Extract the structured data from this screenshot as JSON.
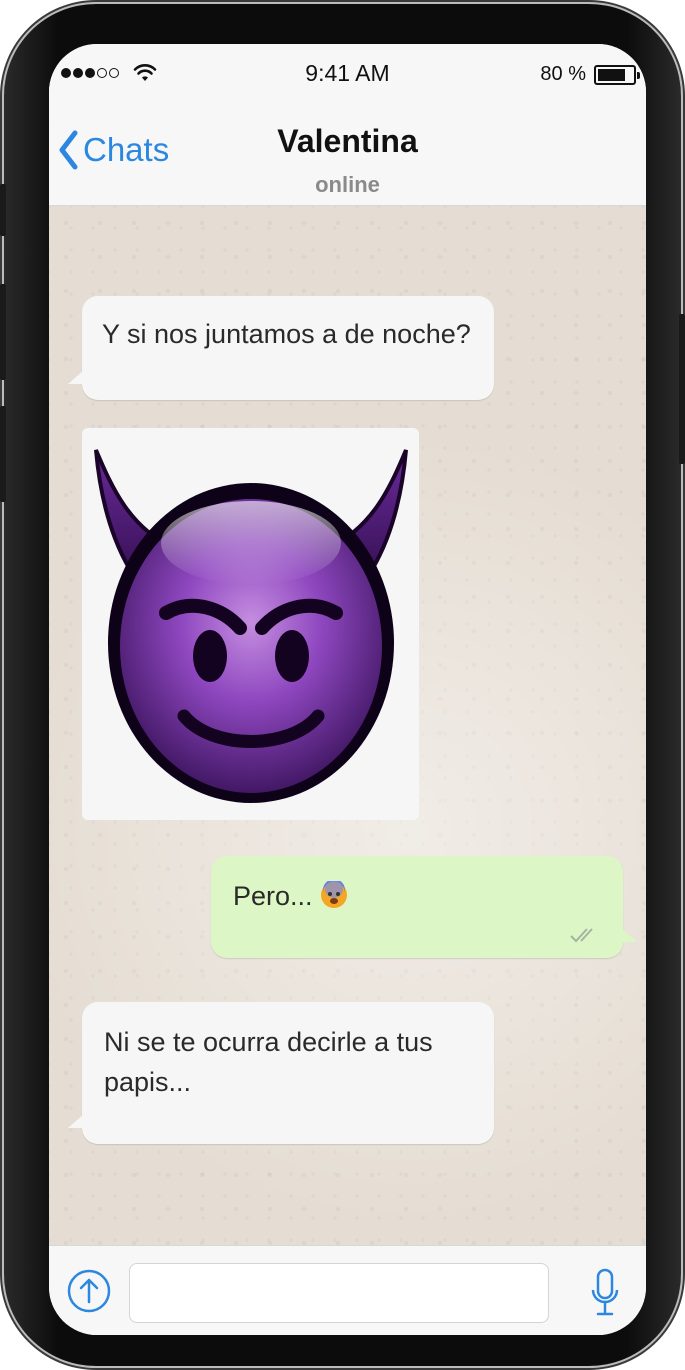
{
  "status_bar": {
    "time": "9:41 AM",
    "battery_percent": "80 %",
    "battery_level": 0.8,
    "signal_bars_filled": 3,
    "signal_bars_total": 5
  },
  "nav": {
    "back_label": "Chats",
    "contact_name": "Valentina",
    "contact_status": "online"
  },
  "messages": [
    {
      "direction": "incoming",
      "type": "text",
      "text": "Y si nos juntamos a de noche?"
    },
    {
      "direction": "incoming",
      "type": "sticker",
      "sticker": "smiling-face-with-horns"
    },
    {
      "direction": "outgoing",
      "type": "text",
      "text": "Pero... ",
      "emoji": "fearful-face",
      "ticks": "double-check"
    },
    {
      "direction": "incoming",
      "type": "text",
      "text": "Ni se te ocurra decirle a tus papis..."
    }
  ],
  "input_bar": {
    "attach_icon": "upload-arrow-icon",
    "text_value": "",
    "mic_icon": "microphone-icon"
  },
  "colors": {
    "accent": "#2b87e0",
    "incoming_bubble": "#f6f6f6",
    "outgoing_bubble": "#dcf7c5",
    "chat_background": "#e5ddd3",
    "sticker_purple": "#8a3fb5"
  }
}
